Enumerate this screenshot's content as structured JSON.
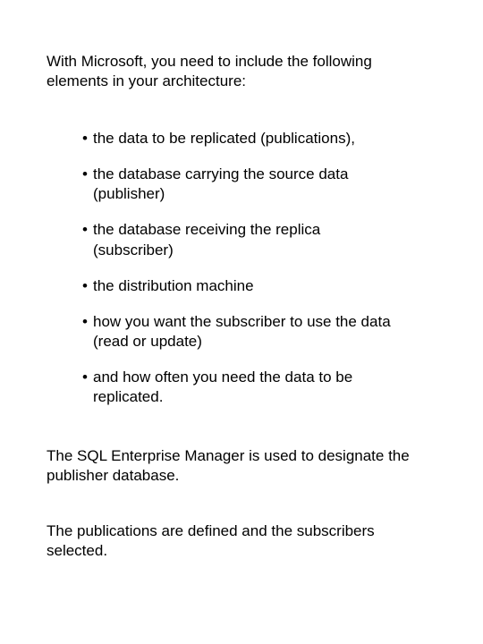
{
  "intro": "With Microsoft, you need to include the following elements in your architecture:",
  "bullets": [
    "the data to be replicated (publications),",
    "the database carrying the source data (publisher)",
    "the database receiving the replica (subscriber)",
    "the distribution machine",
    "how you want the subscriber to use the data (read or update)",
    "and how often you need the data to be replicated."
  ],
  "para1": "The SQL Enterprise Manager is used to designate the publisher database.",
  "para2": "The publications are defined and the subscribers selected."
}
